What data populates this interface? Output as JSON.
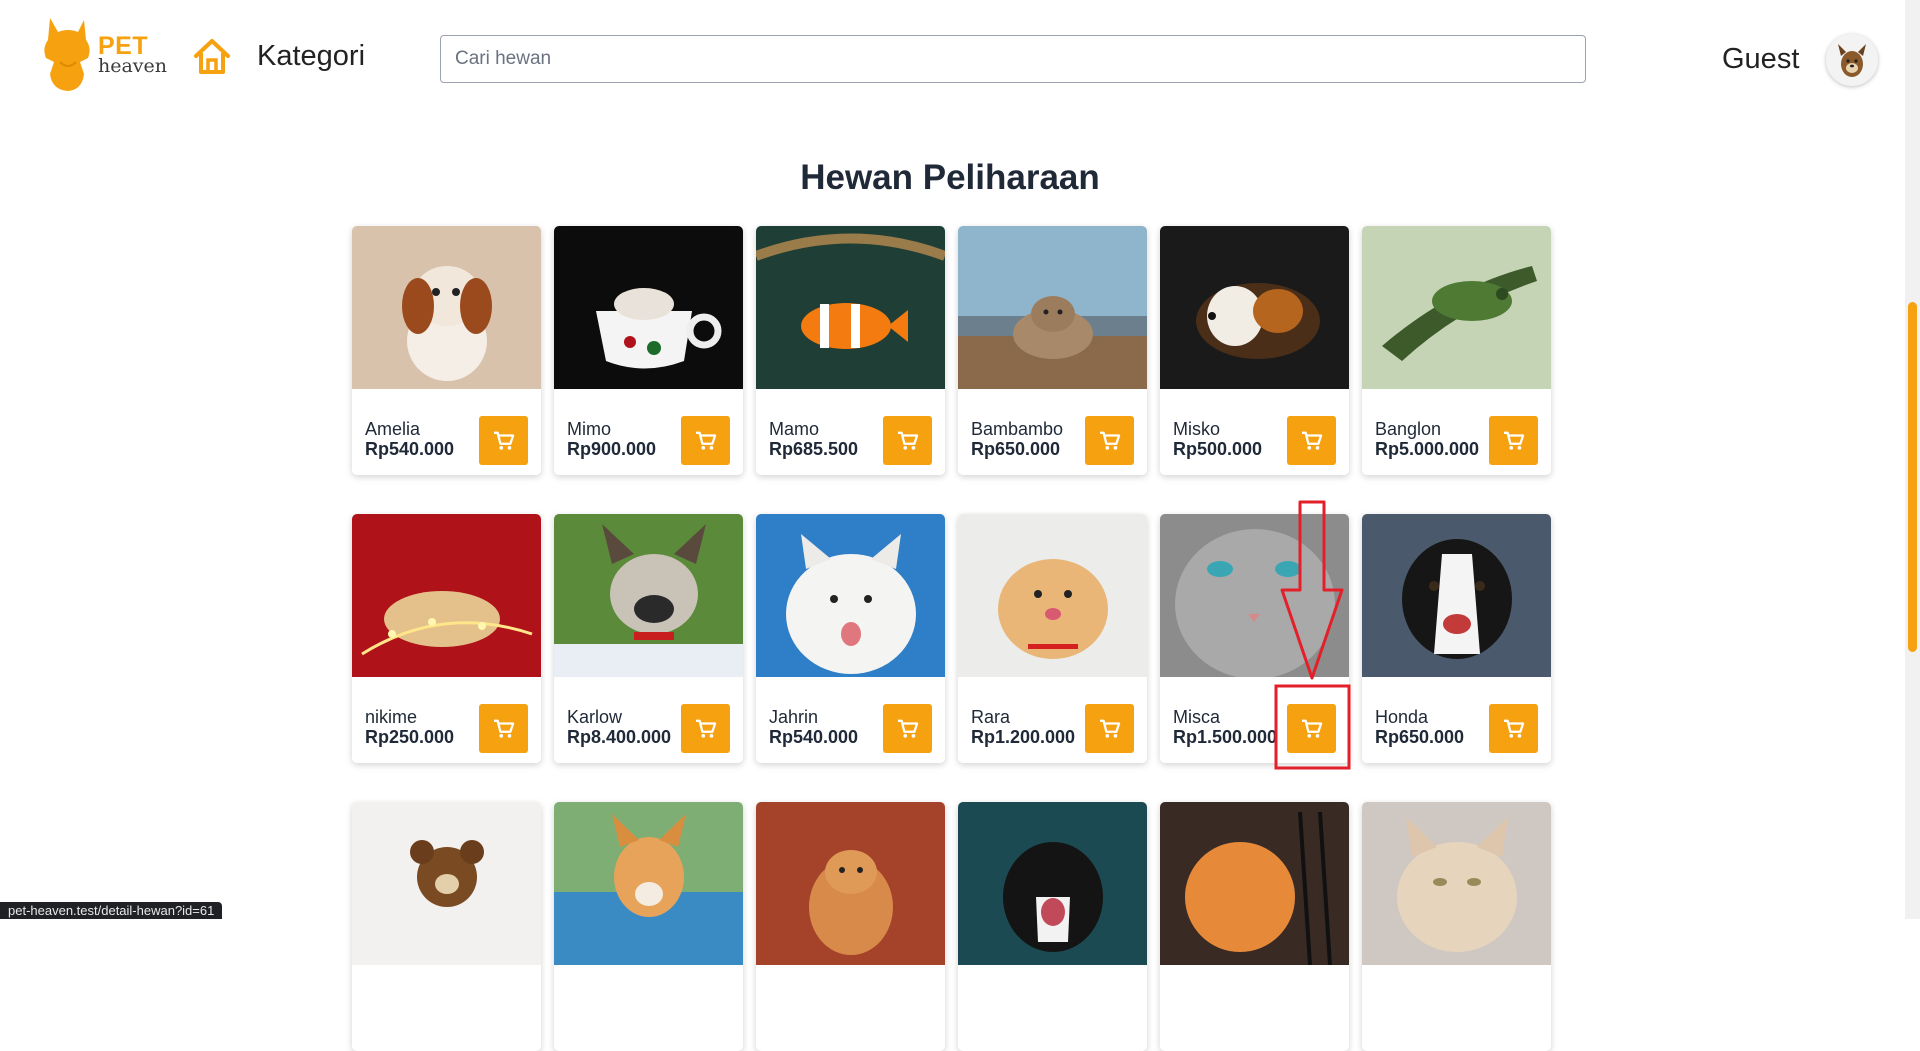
{
  "header": {
    "logo_pet": "PET",
    "logo_heaven": "heaven",
    "kategori_label": "Kategori",
    "search_placeholder": "Cari hewan",
    "user_label": "Guest"
  },
  "main": {
    "title": "Hewan Peliharaan",
    "pets": [
      {
        "name": "Amelia",
        "price": "Rp540.000",
        "photo": "spaniel-dog"
      },
      {
        "name": "Mimo",
        "price": "Rp900.000",
        "photo": "hamster-in-cup"
      },
      {
        "name": "Mamo",
        "price": "Rp685.500",
        "photo": "clownfish"
      },
      {
        "name": "Bambambo",
        "price": "Rp650.000",
        "photo": "cat-on-dock"
      },
      {
        "name": "Misko",
        "price": "Rp500.000",
        "photo": "guinea-pig"
      },
      {
        "name": "Banglon",
        "price": "Rp5.000.000",
        "photo": "chameleon"
      },
      {
        "name": "nikime",
        "price": "Rp250.000",
        "photo": "hamster-with-lights"
      },
      {
        "name": "Karlow",
        "price": "Rp8.400.000",
        "photo": "french-bulldog"
      },
      {
        "name": "Jahrin",
        "price": "Rp540.000",
        "photo": "samoyed"
      },
      {
        "name": "Rara",
        "price": "Rp1.200.000",
        "photo": "pomeranian"
      },
      {
        "name": "Misca",
        "price": "Rp1.500.000",
        "photo": "grey-cat"
      },
      {
        "name": "Honda",
        "price": "Rp650.000",
        "photo": "border-collie"
      },
      {
        "name": "",
        "price": "",
        "photo": "dog-in-bear-costume"
      },
      {
        "name": "",
        "price": "",
        "photo": "corgi"
      },
      {
        "name": "",
        "price": "",
        "photo": "orange-cat-autumn"
      },
      {
        "name": "",
        "price": "",
        "photo": "black-white-kitten"
      },
      {
        "name": "",
        "price": "",
        "photo": "orange-kitten"
      },
      {
        "name": "",
        "price": "",
        "photo": "cream-cat"
      }
    ]
  },
  "status_bar": {
    "url": "pet-heaven.test/detail-hewan?id=61"
  },
  "colors": {
    "accent": "#f6a10f",
    "annotation": "#e3202a"
  },
  "icons": {
    "home": "home-icon",
    "cart": "cart-icon",
    "logo": "cat-logo-icon"
  }
}
